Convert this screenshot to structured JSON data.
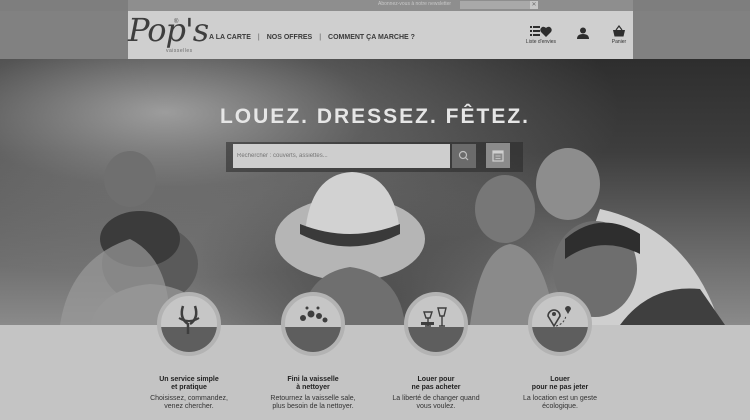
{
  "newsletter": {
    "label": "Abonnez-vous à notre newsletter",
    "placeholder": "",
    "submit_icon": "close-icon"
  },
  "brand": {
    "logo": "Pop's",
    "reg": "®",
    "sub": "vaisselles"
  },
  "nav": {
    "items": [
      "A LA CARTE",
      "NOS OFFRES",
      "COMMENT ÇA MARCHE ?"
    ],
    "separator": "|"
  },
  "header_icons": {
    "wishlist": "Liste d'envies",
    "account": "",
    "cart": "Panier"
  },
  "hero": {
    "tagline": "LOUEZ. DRESSEZ. FÊTEZ.",
    "search_placeholder": "Rechercher : couverts, assiettes...",
    "search_icon": "search-icon",
    "calendar_icon": "calendar-icon"
  },
  "features": [
    {
      "icon": "cutlery-icon",
      "title": "Un service simple\net pratique",
      "text": "Choisissez, commandez,\nvenez chercher."
    },
    {
      "icon": "dirty-dishes-icon",
      "title": "Fini la vaisselle\nà nettoyer",
      "text": "Retournez la vaisselle sale,\nplus besoin de la nettoyer."
    },
    {
      "icon": "glasses-plates-icon",
      "title": "Louer pour\nne pas acheter",
      "text": "La liberté de changer quand\nvous voulez."
    },
    {
      "icon": "location-pin-icon",
      "title": "Louer\npour ne pas jeter",
      "text": "La location est un geste\nécologique."
    }
  ]
}
